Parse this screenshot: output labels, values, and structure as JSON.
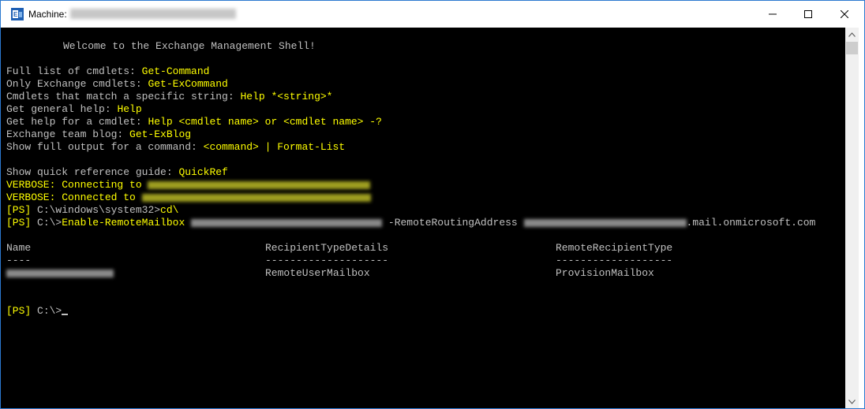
{
  "window": {
    "title_prefix": "Machine:",
    "title_suffix": ""
  },
  "console": {
    "welcome": "Welcome to the Exchange Management Shell!",
    "help_lines": [
      {
        "label": "Full list of cmdlets: ",
        "value": "Get-Command"
      },
      {
        "label": "Only Exchange cmdlets: ",
        "value": "Get-ExCommand"
      },
      {
        "label": "Cmdlets that match a specific string: ",
        "value": "Help *<string>*"
      },
      {
        "label": "Get general help: ",
        "value": "Help"
      },
      {
        "label": "Get help for a cmdlet: ",
        "value": "Help <cmdlet name> or <cmdlet name> -?"
      },
      {
        "label": "Exchange team blog: ",
        "value": "Get-ExBlog"
      },
      {
        "label": "Show full output for a command: ",
        "value": "<command> | Format-List"
      }
    ],
    "quickref": {
      "label": "Show quick reference guide: ",
      "value": "QuickRef"
    },
    "verbose_connecting": "VERBOSE: Connecting to",
    "verbose_connected": "VERBOSE: Connected to",
    "prompt1": {
      "prompt": "[PS]",
      "path": " C:\\windows\\system32>",
      "cmd": "cd\\"
    },
    "prompt2": {
      "prompt": "[PS]",
      "path": " C:\\>",
      "cmd": "Enable-RemoteMailbox",
      "param": "-RemoteRoutingAddress",
      "suffix": ".mail.onmicrosoft.com"
    },
    "table": {
      "headers": [
        "Name",
        "RecipientTypeDetails",
        "RemoteRecipientType"
      ],
      "separators": [
        "----",
        "--------------------",
        "-------------------"
      ],
      "row": [
        "",
        "RemoteUserMailbox",
        "ProvisionMailbox"
      ]
    },
    "prompt3": {
      "prompt": "[PS]",
      "path": " C:\\>"
    }
  },
  "colors": {
    "console_bg": "#000000",
    "console_text": "#c0c0c0",
    "highlight": "#ffff00",
    "window_border": "#2b79d0"
  }
}
